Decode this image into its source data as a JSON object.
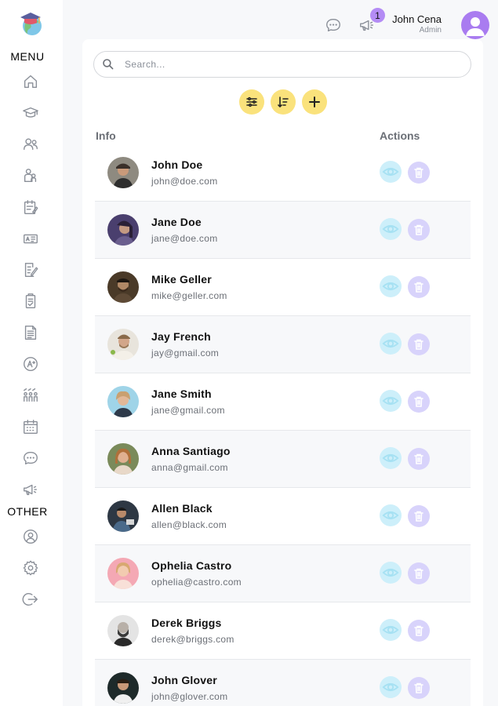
{
  "sidebar": {
    "menu_title": "MENU",
    "other_title": "OTHER",
    "menu_icons": [
      "home-icon",
      "graduation-cap-icon",
      "users-icon",
      "parent-icon",
      "schedule-icon",
      "id-card-icon",
      "document-edit-icon",
      "exam-icon",
      "report-icon",
      "result-icon",
      "class-icon",
      "calendar-icon",
      "message-icon",
      "announcement-icon"
    ],
    "other_icons": [
      "profile-icon",
      "settings-icon",
      "logout-icon"
    ]
  },
  "topbar": {
    "notification_count": "1",
    "user_name": "John Cena",
    "user_role": "Admin"
  },
  "search": {
    "placeholder": "Search..."
  },
  "table": {
    "col_info": "Info",
    "col_actions": "Actions",
    "rows": [
      {
        "name": "John Doe",
        "email": "john@doe.com"
      },
      {
        "name": "Jane Doe",
        "email": "jane@doe.com"
      },
      {
        "name": "Mike Geller",
        "email": "mike@geller.com"
      },
      {
        "name": "Jay French",
        "email": "jay@gmail.com"
      },
      {
        "name": "Jane Smith",
        "email": "jane@gmail.com"
      },
      {
        "name": "Anna Santiago",
        "email": "anna@gmail.com"
      },
      {
        "name": "Allen Black",
        "email": "allen@black.com"
      },
      {
        "name": "Ophelia Castro",
        "email": "ophelia@castro.com"
      },
      {
        "name": "Derek Briggs",
        "email": "derek@briggs.com"
      },
      {
        "name": "John Glover",
        "email": "john@glover.com"
      }
    ]
  },
  "colors": {
    "accent_yellow": "#fae27c",
    "view_blue": "#cdeffa",
    "delete_purple": "#d8d3fb",
    "avatar_purple": "#a97cf0"
  }
}
